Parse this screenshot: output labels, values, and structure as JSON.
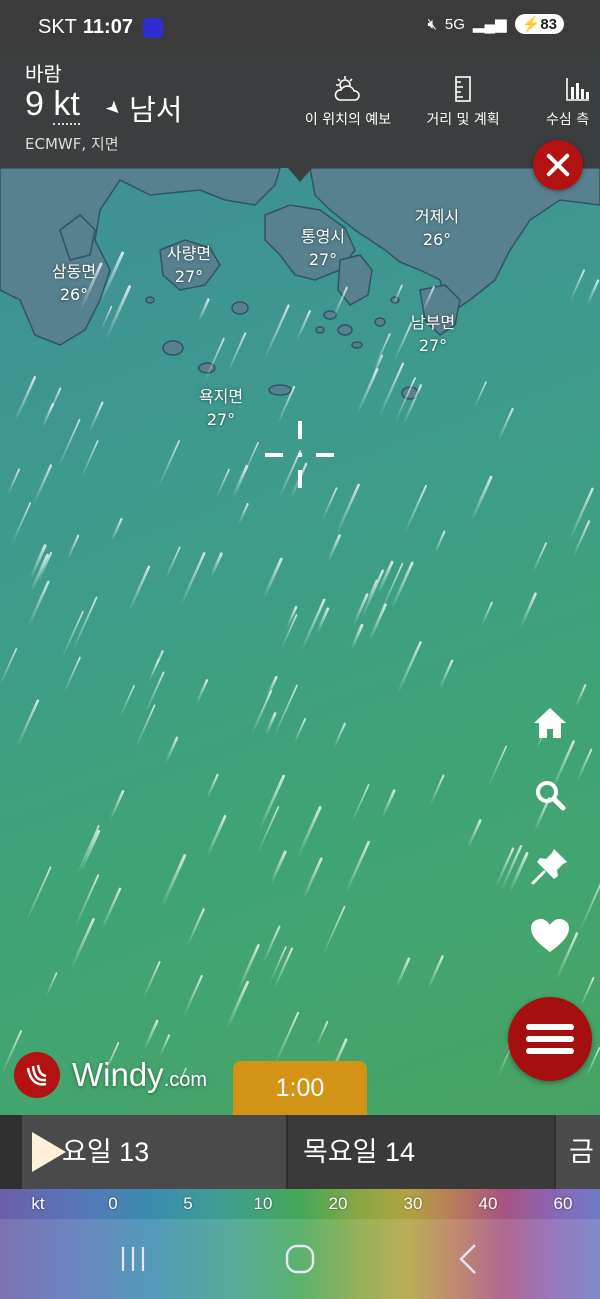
{
  "status_bar": {
    "carrier": "SKT",
    "time": "11:07",
    "network": "5G",
    "battery": "83"
  },
  "header": {
    "layer_title": "바람",
    "wind_speed": "9",
    "wind_unit": "kt",
    "wind_direction": "남서",
    "model_info": "ECMWF, 지면",
    "buttons": [
      {
        "label": "이 위치의 예보",
        "icon": "cloud-sun-icon"
      },
      {
        "label": "거리 및 계획",
        "icon": "ruler-icon"
      },
      {
        "label": "수심 측",
        "icon": "bar-chart-icon"
      }
    ]
  },
  "map": {
    "places": [
      {
        "name": "삼동면",
        "temp": "26°"
      },
      {
        "name": "사량면",
        "temp": "27°"
      },
      {
        "name": "통영시",
        "temp": "27°"
      },
      {
        "name": "거제시",
        "temp": "26°"
      },
      {
        "name": "남부면",
        "temp": "27°"
      },
      {
        "name": "욕지면",
        "temp": "27°"
      }
    ]
  },
  "tools": [
    "home-icon",
    "search-icon",
    "pin-icon",
    "heart-icon",
    "menu-icon"
  ],
  "logo": {
    "name": "Windy",
    "suffix": ".com"
  },
  "timeline": {
    "current_time": "1:00",
    "days": [
      "요일 13",
      "목요일 14",
      "금요"
    ]
  },
  "legend": {
    "unit": "kt",
    "ticks": [
      "0",
      "5",
      "10",
      "20",
      "30",
      "40",
      "60"
    ]
  },
  "colors": {
    "accent_red": "#b31212",
    "time_badge": "#d39416",
    "header_bg": "#3a3a3a"
  }
}
